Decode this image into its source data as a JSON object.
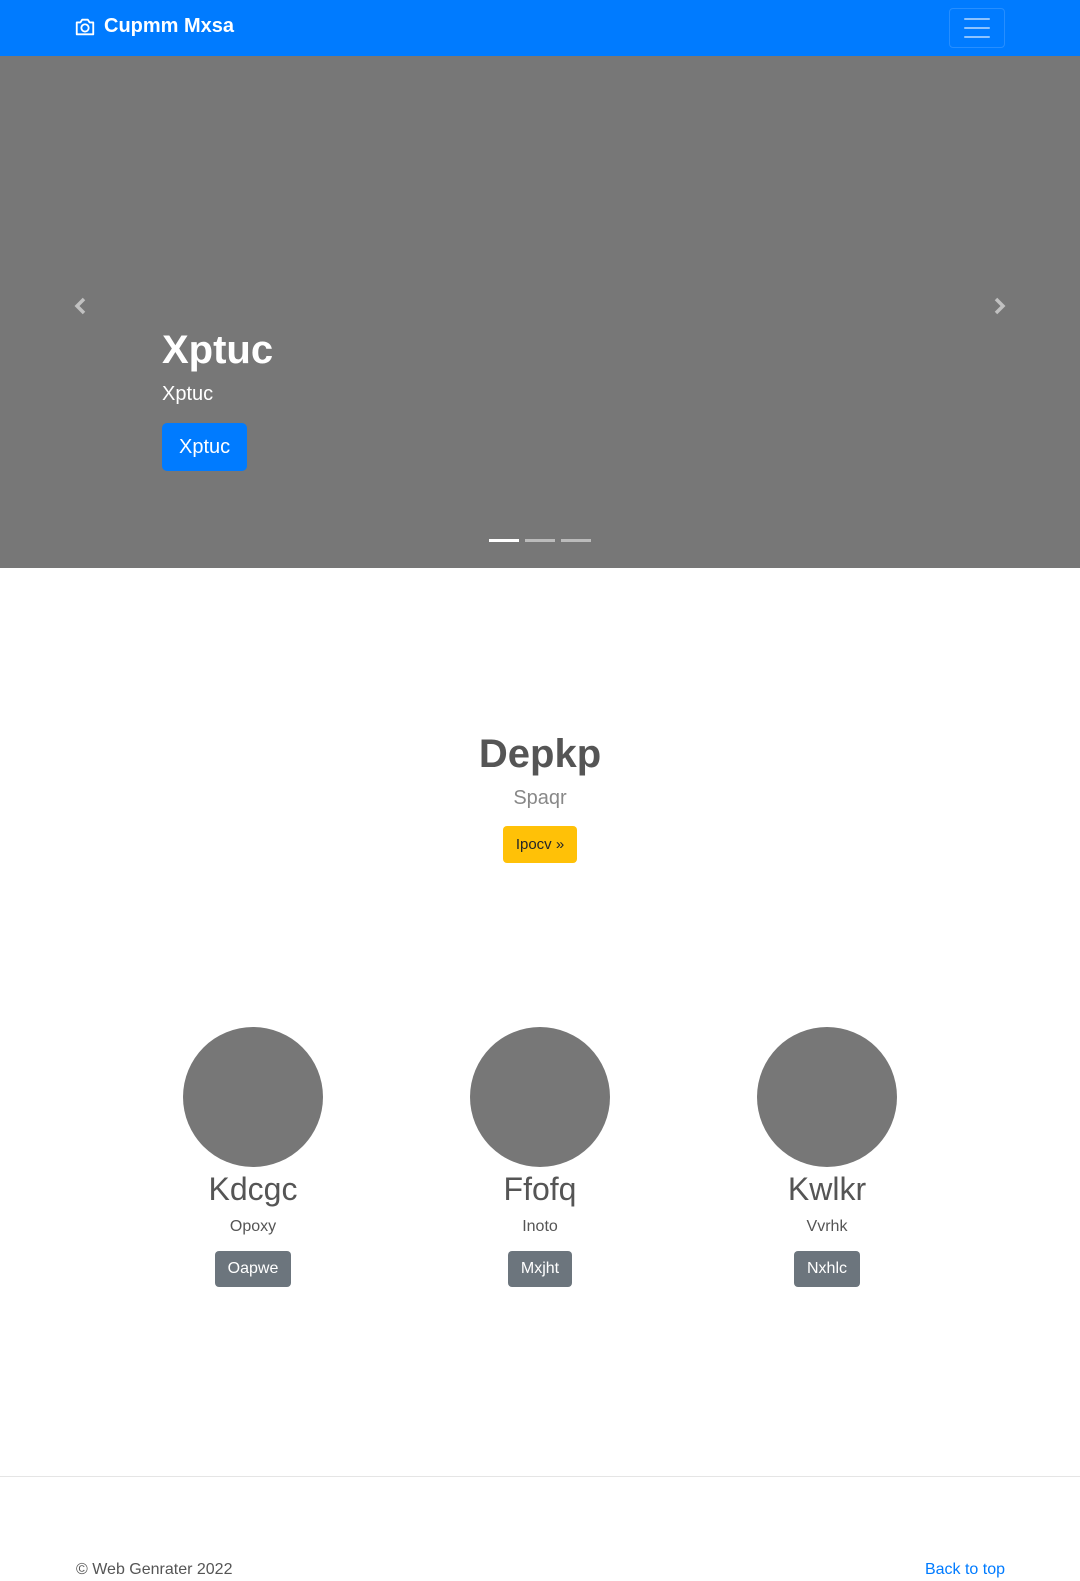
{
  "navbar": {
    "brand": "Cupmm Mxsa",
    "brand_icon": "camera-icon",
    "toggler_icon": "hamburger-menu-icon",
    "color": "#007bff"
  },
  "carousel": {
    "title": "Xptuc",
    "subtitle": "Xptuc",
    "button_label": "Xptuc",
    "prev_icon": "chevron-left-icon",
    "next_icon": "chevron-right-icon",
    "slide_count": 3,
    "active_slide": 1,
    "background": "#777777"
  },
  "hero": {
    "title": "Depkp",
    "subtitle": "Spaqr",
    "button_label": "Ipocv »",
    "button_color": "#ffc107"
  },
  "features": [
    {
      "title": "Kdcgc",
      "text": "Opoxy",
      "button_label": "Oapwe"
    },
    {
      "title": "Ffofq",
      "text": "Inoto",
      "button_label": "Mxjht"
    },
    {
      "title": "Kwlkr",
      "text": "Vvrhk",
      "button_label": "Nxhlc"
    }
  ],
  "footer": {
    "copyright": "© Web Genrater 2022",
    "back_to_top": "Back to top"
  }
}
